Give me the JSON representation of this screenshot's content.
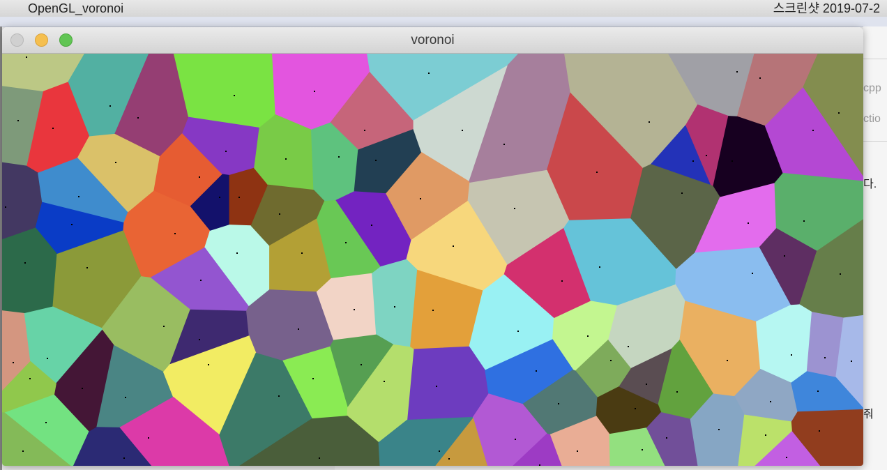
{
  "background": {
    "app_label": "OpenGL_voronoi",
    "screenshot_label": "스크린샷 2019-07-2",
    "right_fragments": [
      "cpp",
      "ctio",
      "다.",
      "줘"
    ]
  },
  "window": {
    "title": "voronoi",
    "buttons": [
      "close",
      "minimize",
      "zoom"
    ]
  },
  "diagram": {
    "type": "voronoi",
    "seed_color": "#000000",
    "cells": [
      {
        "color": "#bcc885"
      },
      {
        "color": "#52b0a2"
      },
      {
        "color": "#953e73"
      },
      {
        "color": "#7ae343"
      },
      {
        "color": "#e355df"
      },
      {
        "color": "#c6657a"
      },
      {
        "color": "#7ccdd3"
      },
      {
        "color": "#a67f9c"
      },
      {
        "color": "#ca484b"
      },
      {
        "color": "#b4b394"
      },
      {
        "color": "#a0a0a6"
      },
      {
        "color": "#b67478"
      },
      {
        "color": "#838d4f"
      },
      {
        "color": "#e9363d"
      },
      {
        "color": "#7e9a7a"
      },
      {
        "color": "#dac169"
      },
      {
        "color": "#e65c32"
      },
      {
        "color": "#8638c4"
      },
      {
        "color": "#13116b"
      },
      {
        "color": "#8e3312"
      },
      {
        "color": "#79cb47"
      },
      {
        "color": "#5ec27e"
      },
      {
        "color": "#223f53"
      },
      {
        "color": "#cdd9d1"
      },
      {
        "color": "#2332b8"
      },
      {
        "color": "#b13271"
      },
      {
        "color": "#170020"
      },
      {
        "color": "#b448d3"
      },
      {
        "color": "#433862"
      },
      {
        "color": "#3f8ccd"
      },
      {
        "color": "#0a3cc6"
      },
      {
        "color": "#e96434"
      },
      {
        "color": "#baf9e8"
      },
      {
        "color": "#6f6b2f"
      },
      {
        "color": "#b3a035"
      },
      {
        "color": "#69c855"
      },
      {
        "color": "#7323c1"
      },
      {
        "color": "#e09a64"
      },
      {
        "color": "#c6c5b1"
      },
      {
        "color": "#5b6548"
      },
      {
        "color": "#e36ced"
      },
      {
        "color": "#5aaf6b"
      },
      {
        "color": "#5e2e62"
      },
      {
        "color": "#f7d77c"
      },
      {
        "color": "#d3306e"
      },
      {
        "color": "#65c3d9"
      },
      {
        "color": "#8abdef"
      },
      {
        "color": "#667e4a"
      },
      {
        "color": "#2c6a4a"
      },
      {
        "color": "#8b9a39"
      },
      {
        "color": "#9355d0"
      },
      {
        "color": "#99bd61"
      },
      {
        "color": "#3e2970"
      },
      {
        "color": "#77618c"
      },
      {
        "color": "#f2d4c6"
      },
      {
        "color": "#7ed4c2"
      },
      {
        "color": "#e3a03a"
      },
      {
        "color": "#99f1f3"
      },
      {
        "color": "#c3f690"
      },
      {
        "color": "#7eab5b"
      },
      {
        "color": "#c5d6c0"
      },
      {
        "color": "#eab061"
      },
      {
        "color": "#b6f7f2"
      },
      {
        "color": "#9c93d1"
      },
      {
        "color": "#a7b9e9"
      },
      {
        "color": "#d49680"
      },
      {
        "color": "#67d3a7"
      },
      {
        "color": "#441636"
      },
      {
        "color": "#4a8584"
      },
      {
        "color": "#f2ec63"
      },
      {
        "color": "#569f52"
      },
      {
        "color": "#8aeb53"
      },
      {
        "color": "#6d3cbf"
      },
      {
        "color": "#2f70e1"
      },
      {
        "color": "#62a23e"
      },
      {
        "color": "#8fa7c4"
      },
      {
        "color": "#3f86db"
      },
      {
        "color": "#90c84c"
      },
      {
        "color": "#73e281"
      },
      {
        "color": "#dc3aa8"
      },
      {
        "color": "#3c7a68"
      },
      {
        "color": "#b4de6c"
      },
      {
        "color": "#517874"
      },
      {
        "color": "#4a3b12"
      },
      {
        "color": "#5a4d52"
      },
      {
        "color": "#84ba58"
      },
      {
        "color": "#2b2a74"
      },
      {
        "color": "#4a5e3a"
      },
      {
        "color": "#3a8489"
      },
      {
        "color": "#b259d4"
      },
      {
        "color": "#e9ad95"
      },
      {
        "color": "#93e07f"
      },
      {
        "color": "#714f99"
      },
      {
        "color": "#86a6c4"
      },
      {
        "color": "#bbe16a"
      },
      {
        "color": "#c25fe2"
      },
      {
        "color": "#913d1e"
      },
      {
        "color": "#c79a3e"
      },
      {
        "color": "#9d3bc4"
      }
    ]
  }
}
